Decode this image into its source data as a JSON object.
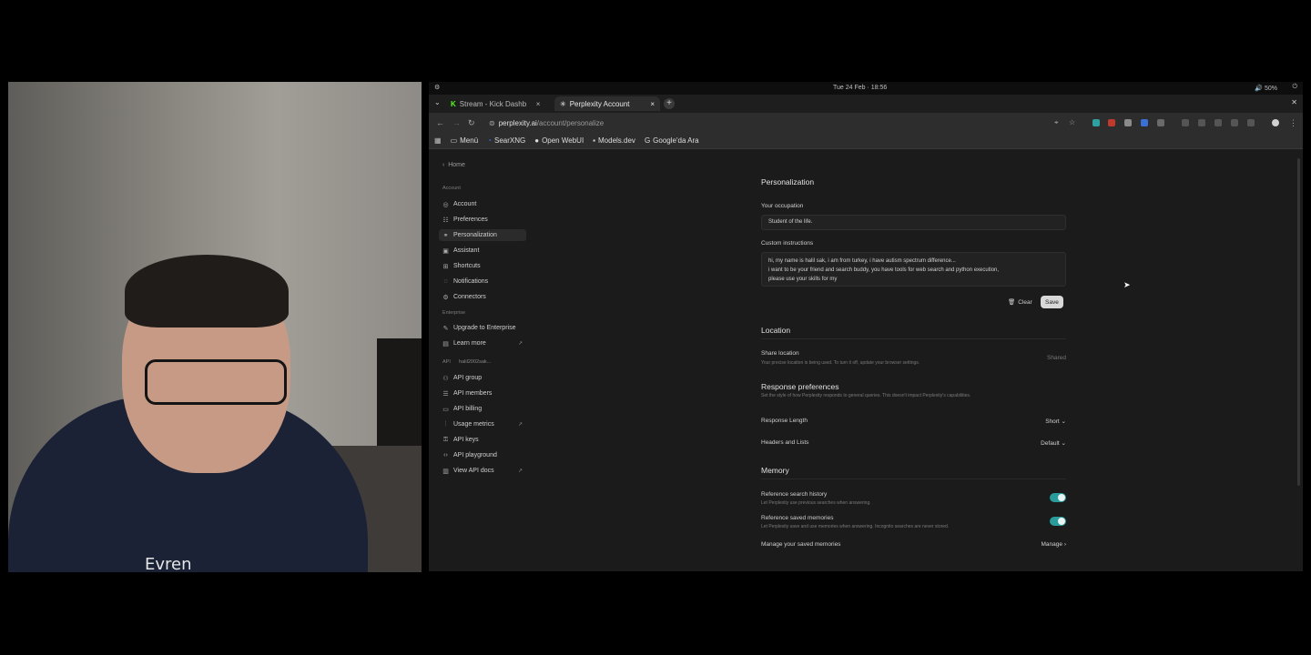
{
  "system_bar": {
    "clock": "Tue 24 Feb · 18:56",
    "battery": "50%"
  },
  "tabs": [
    {
      "label": "Stream - Kick Dashb",
      "active": false
    },
    {
      "label": "Perplexity Account",
      "active": true
    }
  ],
  "address": {
    "domain": "perplexity.ai",
    "path": "/account/personalize"
  },
  "bookmarks": [
    "Menü",
    "SearXNG",
    "Open WebUI",
    "Models.dev",
    "Google'da Ara"
  ],
  "sidebar": {
    "home": "Home",
    "account_header": "Account",
    "account_items": [
      "Account",
      "Preferences",
      "Personalization",
      "Assistant",
      "Shortcuts",
      "Notifications",
      "Connectors"
    ],
    "enterprise_header": "Enterprise",
    "enterprise_items": [
      "Upgrade to Enterprise",
      "Learn more"
    ],
    "api_header": "API",
    "api_account": "halil2002sak...",
    "api_items": [
      "API group",
      "API members",
      "API billing",
      "Usage metrics",
      "API keys",
      "API playground",
      "View API docs"
    ]
  },
  "personalization": {
    "title": "Personalization",
    "occupation_label": "Your occupation",
    "occupation_value": "Student of the life.",
    "instructions_label": "Custom instructions",
    "instructions_lines": [
      "hi, my name is halil sak, i am from turkey, i have autism spectrum difference...",
      "i want to be your friend and search buddy, you have tools for web search and python execution,",
      "please use your skills for my"
    ],
    "clear_label": "Clear",
    "save_label": "Save"
  },
  "location": {
    "title": "Location",
    "share_label": "Share location",
    "share_desc": "Your precise location is being used. To turn it off, update your browser settings.",
    "share_status": "Shared"
  },
  "response": {
    "title": "Response preferences",
    "desc": "Set the style of how Perplexity responds to general queries. This doesn't impact Perplexity's capabilities.",
    "length_label": "Response Length",
    "length_value": "Short",
    "headers_label": "Headers and Lists",
    "headers_value": "Default"
  },
  "memory": {
    "title": "Memory",
    "search_history_label": "Reference search history",
    "search_history_desc": "Let Perplexity use previous searches when answering.",
    "search_history_on": true,
    "saved_memories_label": "Reference saved memories",
    "saved_memories_desc": "Let Perplexity save and use memories when answering. Incognito searches are never stored.",
    "saved_memories_on": true,
    "manage_label": "Manage your saved memories",
    "manage_button": "Manage"
  },
  "webcam": {
    "shirt_logo": "Evren"
  }
}
